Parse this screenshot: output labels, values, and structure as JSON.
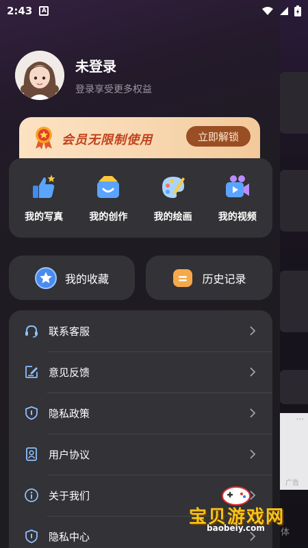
{
  "status_bar": {
    "time": "2:43",
    "a_icon": "A"
  },
  "profile": {
    "name": "未登录",
    "subtitle": "登录享受更多权益"
  },
  "vip": {
    "text": "会员无限制使用",
    "button": "立即解锁"
  },
  "features": [
    {
      "label": "我的写真",
      "icon": "thumbs-up-icon"
    },
    {
      "label": "我的创作",
      "icon": "smile-folder-icon"
    },
    {
      "label": "我的绘画",
      "icon": "palette-icon"
    },
    {
      "label": "我的视频",
      "icon": "video-camera-icon"
    }
  ],
  "quick": {
    "favorites": "我的收藏",
    "history": "历史记录"
  },
  "menu": [
    {
      "label": "联系客服",
      "icon": "headset-icon"
    },
    {
      "label": "意见反馈",
      "icon": "edit-icon"
    },
    {
      "label": "隐私政策",
      "icon": "shield-icon"
    },
    {
      "label": "用户协议",
      "icon": "user-doc-icon"
    },
    {
      "label": "关于我们",
      "icon": "info-icon"
    },
    {
      "label": "隐私中心",
      "icon": "shield-icon"
    }
  ],
  "background": {
    "ad_label": "广告",
    "body_text": "体"
  },
  "watermark": {
    "title": "宝贝游戏网",
    "url": "baobeiy.com"
  },
  "colors": {
    "accent_icon": "#8ec0ff",
    "vip_text": "#c2421e",
    "vip_button": "#9a4e24",
    "card": "#333236"
  }
}
